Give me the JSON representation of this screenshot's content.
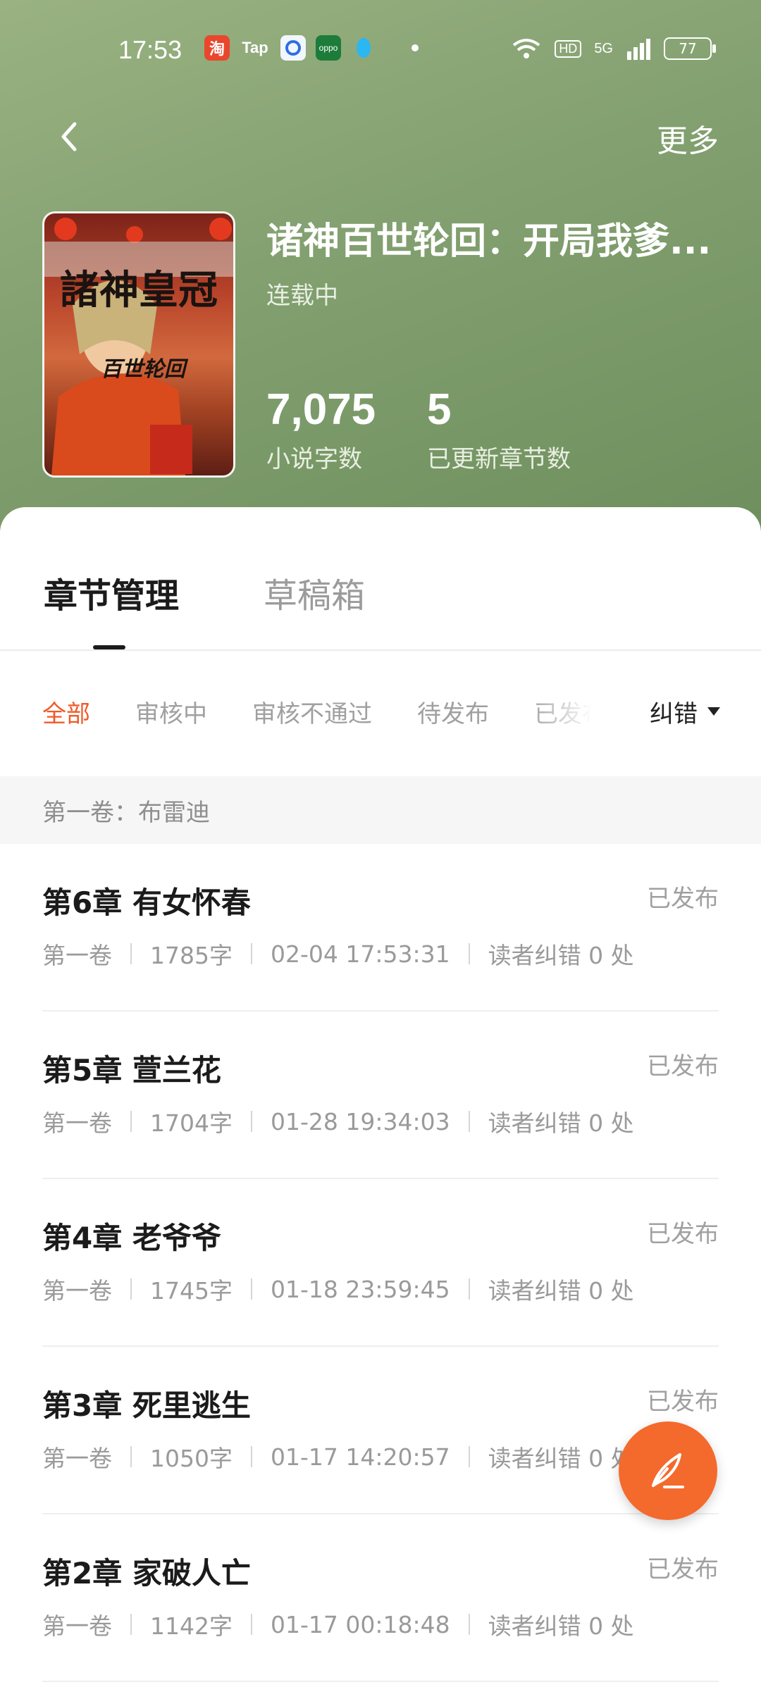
{
  "status_bar": {
    "time": "17:53",
    "app_icons": [
      "taobao-icon",
      "tap-icon",
      "cloud-app-icon",
      "oppo-icon",
      "qq-icon"
    ],
    "tap_label": "Tap",
    "oppo_label": "oppo",
    "network": "5G",
    "hd_label": "HD",
    "battery": "77"
  },
  "topbar": {
    "more_label": "更多"
  },
  "book": {
    "title": "诸神百世轮回：开局我爹...",
    "status": "连载中",
    "cover_title": "諸神皇冠",
    "cover_subtitle": "百世轮回",
    "stats": [
      {
        "value": "7,075",
        "label": "小说字数"
      },
      {
        "value": "5",
        "label": "已更新章节数"
      }
    ]
  },
  "tabs": [
    {
      "label": "章节管理",
      "active": true
    },
    {
      "label": "草稿箱",
      "active": false
    }
  ],
  "filters": {
    "items": [
      "全部",
      "审核中",
      "审核不通过",
      "待发布",
      "已发布"
    ],
    "active_index": 0,
    "correction_label": "纠错"
  },
  "volume": {
    "label": "第一卷：布雷迪"
  },
  "chapters": [
    {
      "title": "第6章 有女怀春",
      "status": "已发布",
      "volume": "第一卷",
      "words": "1785字",
      "time": "02-04 17:53:31",
      "corrections": "读者纠错 0 处"
    },
    {
      "title": "第5章 萱兰花",
      "status": "已发布",
      "volume": "第一卷",
      "words": "1704字",
      "time": "01-28 19:34:03",
      "corrections": "读者纠错 0 处"
    },
    {
      "title": "第4章 老爷爷",
      "status": "已发布",
      "volume": "第一卷",
      "words": "1745字",
      "time": "01-18 23:59:45",
      "corrections": "读者纠错 0 处"
    },
    {
      "title": "第3章 死里逃生",
      "status": "已发布",
      "volume": "第一卷",
      "words": "1050字",
      "time": "01-17 14:20:57",
      "corrections": "读者纠错 0 处"
    },
    {
      "title": "第2章 家破人亡",
      "status": "已发布",
      "volume": "第一卷",
      "words": "1142字",
      "time": "01-17 00:18:48",
      "corrections": "读者纠错 0 处"
    }
  ],
  "colors": {
    "accent": "#f05a28",
    "fab": "#f46a2c",
    "header_bg": "#83a070"
  }
}
